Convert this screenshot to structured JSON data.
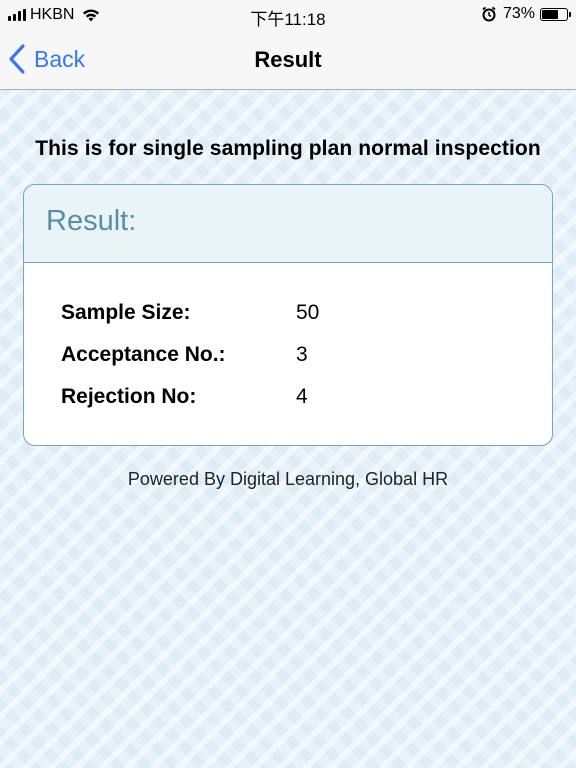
{
  "status_bar": {
    "carrier": "HKBN",
    "time": "下午11:18",
    "battery_percent": "73%",
    "battery_level": 0.73,
    "icons": [
      "signal-icon",
      "wifi-icon",
      "alarm-icon",
      "battery-icon"
    ]
  },
  "nav": {
    "back_label": "Back",
    "title": "Result",
    "accent_color": "#3478f6"
  },
  "intro": "This is for single sampling plan normal inspection",
  "card": {
    "title": "Result:",
    "rows": [
      {
        "label": "Sample Size:",
        "value": "50"
      },
      {
        "label": "Acceptance No.:",
        "value": "3"
      },
      {
        "label": "Rejection No:",
        "value": "4"
      }
    ]
  },
  "footer": "Powered By Digital Learning, Global HR"
}
